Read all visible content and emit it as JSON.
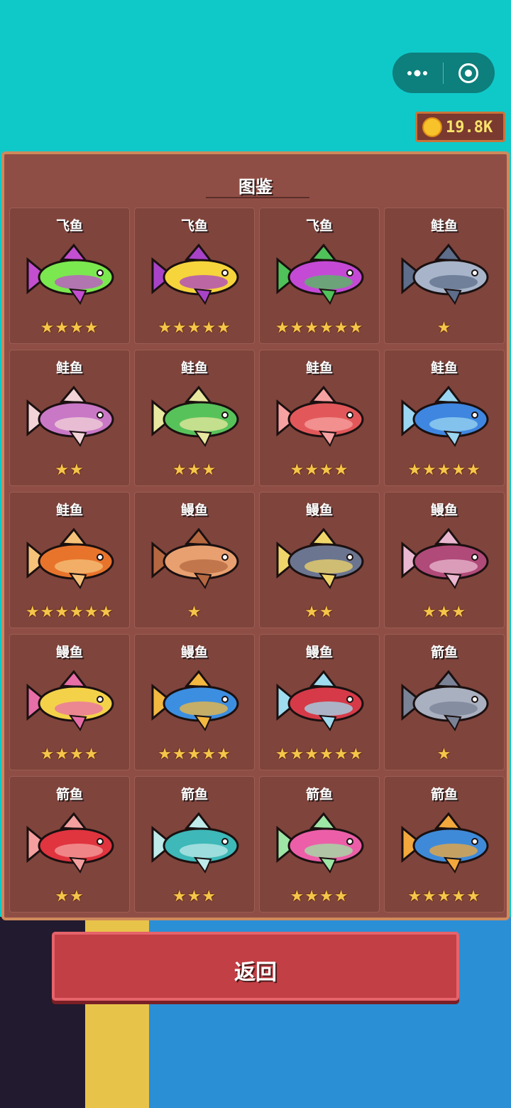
{
  "top": {
    "coins": "19.8K"
  },
  "panel": {
    "title": "图鉴"
  },
  "fish": [
    {
      "name": "飞鱼",
      "stars": "★★★★",
      "rating": 4,
      "colors": [
        "#7be84f",
        "#c34fd0"
      ]
    },
    {
      "name": "飞鱼",
      "stars": "★★★★★",
      "rating": 5,
      "colors": [
        "#f6d43c",
        "#a843c7"
      ]
    },
    {
      "name": "飞鱼",
      "stars": "★★★★★★",
      "rating": 6,
      "colors": [
        "#c44ad6",
        "#4fc25a"
      ]
    },
    {
      "name": "鲑鱼",
      "stars": "★",
      "rating": 1,
      "colors": [
        "#a7b4c9",
        "#5d6d8a"
      ]
    },
    {
      "name": "鲑鱼",
      "stars": "★★",
      "rating": 2,
      "colors": [
        "#c978c6",
        "#f2d4d8"
      ]
    },
    {
      "name": "鲑鱼",
      "stars": "★★★",
      "rating": 3,
      "colors": [
        "#58c25a",
        "#e8e8a0"
      ]
    },
    {
      "name": "鲑鱼",
      "stars": "★★★★",
      "rating": 4,
      "colors": [
        "#e2585a",
        "#f7a2a2"
      ]
    },
    {
      "name": "鲑鱼",
      "stars": "★★★★★",
      "rating": 5,
      "colors": [
        "#3f86e0",
        "#9ad6f2"
      ]
    },
    {
      "name": "鲑鱼",
      "stars": "★★★★★★",
      "rating": 6,
      "colors": [
        "#e8742c",
        "#f6c27a"
      ]
    },
    {
      "name": "鳗鱼",
      "stars": "★",
      "rating": 1,
      "colors": [
        "#e8a070",
        "#b56840"
      ]
    },
    {
      "name": "鳗鱼",
      "stars": "★★",
      "rating": 2,
      "colors": [
        "#6b7590",
        "#f0d66a"
      ]
    },
    {
      "name": "鳗鱼",
      "stars": "★★★",
      "rating": 3,
      "colors": [
        "#b04a78",
        "#e9b8d0"
      ]
    },
    {
      "name": "鳗鱼",
      "stars": "★★★★",
      "rating": 4,
      "colors": [
        "#f3d24a",
        "#e86ea8"
      ]
    },
    {
      "name": "鳗鱼",
      "stars": "★★★★★",
      "rating": 5,
      "colors": [
        "#3c8ee0",
        "#f2b840"
      ]
    },
    {
      "name": "鳗鱼",
      "stars": "★★★★★★",
      "rating": 6,
      "colors": [
        "#d63a48",
        "#9fdcf0"
      ]
    },
    {
      "name": "箭鱼",
      "stars": "★",
      "rating": 1,
      "colors": [
        "#a9b0c0",
        "#7a8296"
      ]
    },
    {
      "name": "箭鱼",
      "stars": "★★",
      "rating": 2,
      "colors": [
        "#e0343f",
        "#f5a0a0"
      ]
    },
    {
      "name": "箭鱼",
      "stars": "★★★",
      "rating": 3,
      "colors": [
        "#3eb8b8",
        "#bfeaea"
      ]
    },
    {
      "name": "箭鱼",
      "stars": "★★★★",
      "rating": 4,
      "colors": [
        "#ec5fa8",
        "#9ee6a6"
      ]
    },
    {
      "name": "箭鱼",
      "stars": "★★★★★",
      "rating": 5,
      "colors": [
        "#3f8ad8",
        "#f2a83c"
      ]
    }
  ],
  "buttons": {
    "back": "返回"
  }
}
